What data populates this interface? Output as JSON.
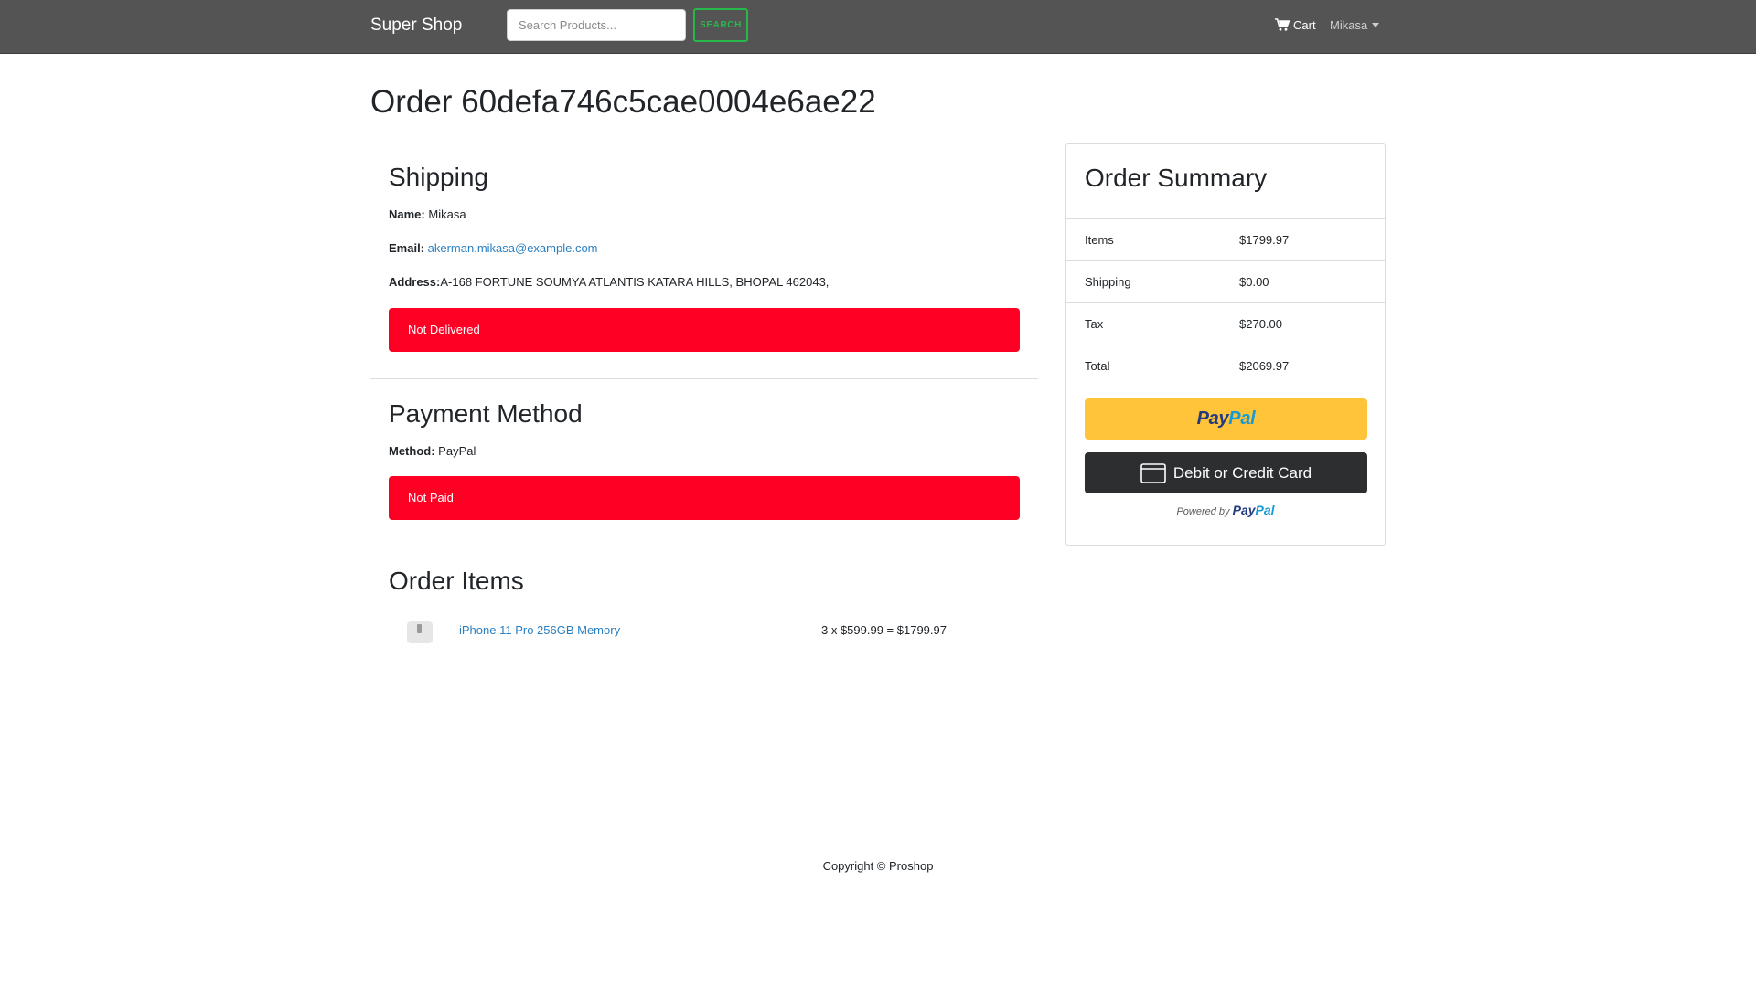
{
  "navbar": {
    "brand": "Super Shop",
    "search_placeholder": "Search Products...",
    "search_button": "SEARCH",
    "cart_label": "Cart",
    "user_name": "Mikasa"
  },
  "page": {
    "title": "Order 60defa746c5cae0004e6ae22"
  },
  "shipping": {
    "heading": "Shipping",
    "name_label": "Name:",
    "name_value": "Mikasa",
    "email_label": "Email:",
    "email_value": "akerman.mikasa@example.com",
    "address_label": "Address:",
    "address_value": "A-168 FORTUNE SOUMYA ATLANTIS KATARA HILLS, BHOPAL 462043,",
    "status": "Not Delivered"
  },
  "payment": {
    "heading": "Payment Method",
    "method_label": "Method:",
    "method_value": "PayPal",
    "status": "Not Paid"
  },
  "order_items": {
    "heading": "Order Items",
    "items": [
      {
        "name": "iPhone 11 Pro 256GB Memory",
        "price_line": "3 x $599.99 = $1799.97"
      }
    ]
  },
  "summary": {
    "heading": "Order Summary",
    "rows": [
      {
        "label": "Items",
        "value": "$1799.97"
      },
      {
        "label": "Shipping",
        "value": "$0.00"
      },
      {
        "label": "Tax",
        "value": "$270.00"
      },
      {
        "label": "Total",
        "value": "$2069.97"
      }
    ],
    "paypal_logo_part1": "Pay",
    "paypal_logo_part2": "Pal",
    "card_button": "Debit or Credit Card",
    "powered_by": "Powered by"
  },
  "footer": {
    "copyright": "Copyright © Proshop"
  },
  "colors": {
    "navbar": "#545454",
    "alert": "#ff0025",
    "link": "#2a7fc1",
    "search_accent": "#28b84a",
    "paypal_yellow": "#ffc439",
    "card_button": "#2c2e2f"
  },
  "icons": {
    "cart": "cart-icon",
    "user_dropdown": "caret-down-icon",
    "card": "credit-card-icon"
  }
}
